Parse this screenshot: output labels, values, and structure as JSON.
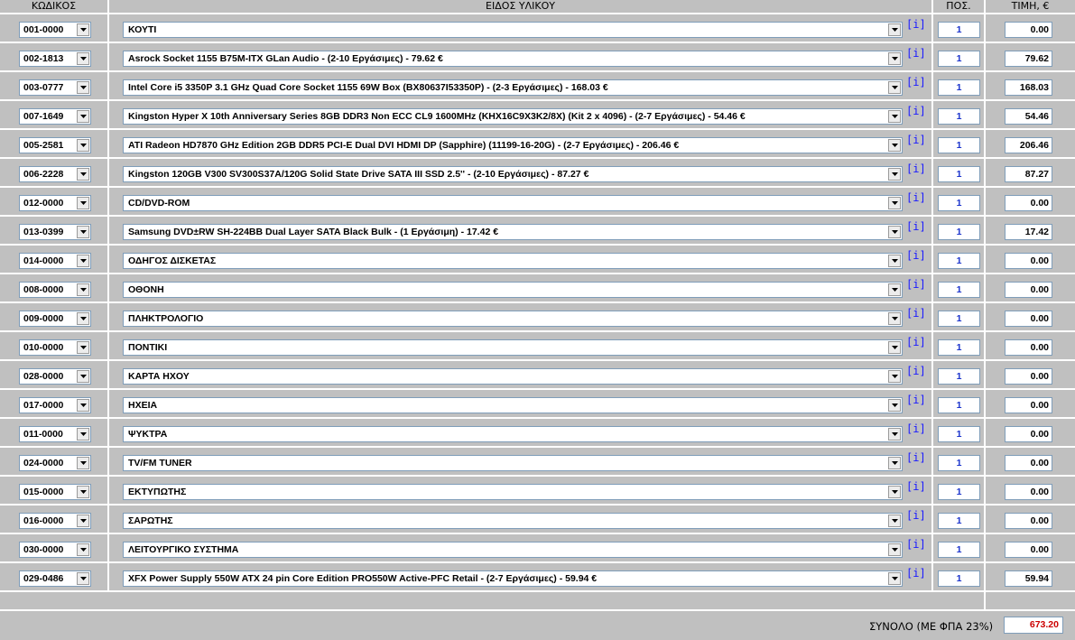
{
  "headers": {
    "code": "ΚΩΔΙΚΟΣ",
    "item": "ΕΙΔΟΣ ΥΛΙΚΟΥ",
    "qty": "ΠΟΣ.",
    "price": "ΤΙΜΗ, €"
  },
  "info_label": "[i]",
  "rows": [
    {
      "code": "001-0000",
      "item": "ΚΟΥΤΙ",
      "qty": "1",
      "price": "0.00"
    },
    {
      "code": "002-1813",
      "item": "Asrock Socket 1155 B75M-ITX GLan Audio - (2-10 Εργάσιμες) - 79.62 €",
      "qty": "1",
      "price": "79.62"
    },
    {
      "code": "003-0777",
      "item": "Intel Core i5 3350P 3.1 GHz Quad Core Socket 1155 69W Box (BX80637I53350P) - (2-3 Εργάσιμες) - 168.03 €",
      "qty": "1",
      "price": "168.03"
    },
    {
      "code": "007-1649",
      "item": "Kingston Hyper X 10th Anniversary Series 8GB DDR3 Non ECC CL9 1600MHz (KHX16C9X3K2/8X) (Kit 2 x 4096) - (2-7 Εργάσιμες) - 54.46 €",
      "qty": "1",
      "price": "54.46"
    },
    {
      "code": "005-2581",
      "item": "ATI Radeon HD7870 GHz Edition 2GB DDR5 PCI-E Dual DVI HDMI DP (Sapphire) (11199-16-20G) - (2-7 Εργάσιμες) - 206.46 €",
      "qty": "1",
      "price": "206.46"
    },
    {
      "code": "006-2228",
      "item": "Kingston 120GB V300 SV300S37A/120G Solid State Drive SATA III SSD 2.5'' - (2-10 Εργάσιμες) - 87.27 €",
      "qty": "1",
      "price": "87.27"
    },
    {
      "code": "012-0000",
      "item": "CD/DVD-ROM",
      "qty": "1",
      "price": "0.00"
    },
    {
      "code": "013-0399",
      "item": "Samsung DVD±RW SH-224BB Dual Layer SATA Black Bulk - (1 Εργάσιμη) - 17.42 €",
      "qty": "1",
      "price": "17.42"
    },
    {
      "code": "014-0000",
      "item": "ΟΔΗΓΟΣ ΔΙΣΚΕΤΑΣ",
      "qty": "1",
      "price": "0.00"
    },
    {
      "code": "008-0000",
      "item": "ΟΘΟΝΗ",
      "qty": "1",
      "price": "0.00"
    },
    {
      "code": "009-0000",
      "item": "ΠΛΗΚΤΡΟΛΟΓΙΟ",
      "qty": "1",
      "price": "0.00"
    },
    {
      "code": "010-0000",
      "item": "ΠΟΝΤΙΚΙ",
      "qty": "1",
      "price": "0.00"
    },
    {
      "code": "028-0000",
      "item": "ΚΑΡΤΑ ΗΧΟΥ",
      "qty": "1",
      "price": "0.00"
    },
    {
      "code": "017-0000",
      "item": "ΗΧΕΙΑ",
      "qty": "1",
      "price": "0.00"
    },
    {
      "code": "011-0000",
      "item": "ΨΥΚΤΡΑ",
      "qty": "1",
      "price": "0.00"
    },
    {
      "code": "024-0000",
      "item": "TV/FM TUNER",
      "qty": "1",
      "price": "0.00"
    },
    {
      "code": "015-0000",
      "item": "ΕΚΤΥΠΩΤΗΣ",
      "qty": "1",
      "price": "0.00"
    },
    {
      "code": "016-0000",
      "item": "ΣΑΡΩΤΗΣ",
      "qty": "1",
      "price": "0.00"
    },
    {
      "code": "030-0000",
      "item": "ΛΕΙΤΟΥΡΓΙΚΟ ΣΥΣΤΗΜΑ",
      "qty": "1",
      "price": "0.00"
    },
    {
      "code": "029-0486",
      "item": "XFX Power Supply 550W ATX 24 pin Core Edition PRO550W Active-PFC Retail - (2-7 Εργάσιμες) - 59.94 €",
      "qty": "1",
      "price": "59.94"
    }
  ],
  "total": {
    "label": "ΣΥΝΟΛΟ (ΜΕ ΦΠΑ 23%)",
    "value": "673.20"
  },
  "colors": {
    "cell_bg": "#c0c0c0",
    "grid_line": "#ffffff",
    "qty_text": "#1a33cc",
    "total_text": "#cc0000",
    "info_link": "#1a1aff"
  },
  "icons": {
    "dropdown": "chevron-down-icon",
    "info": "info-icon"
  }
}
